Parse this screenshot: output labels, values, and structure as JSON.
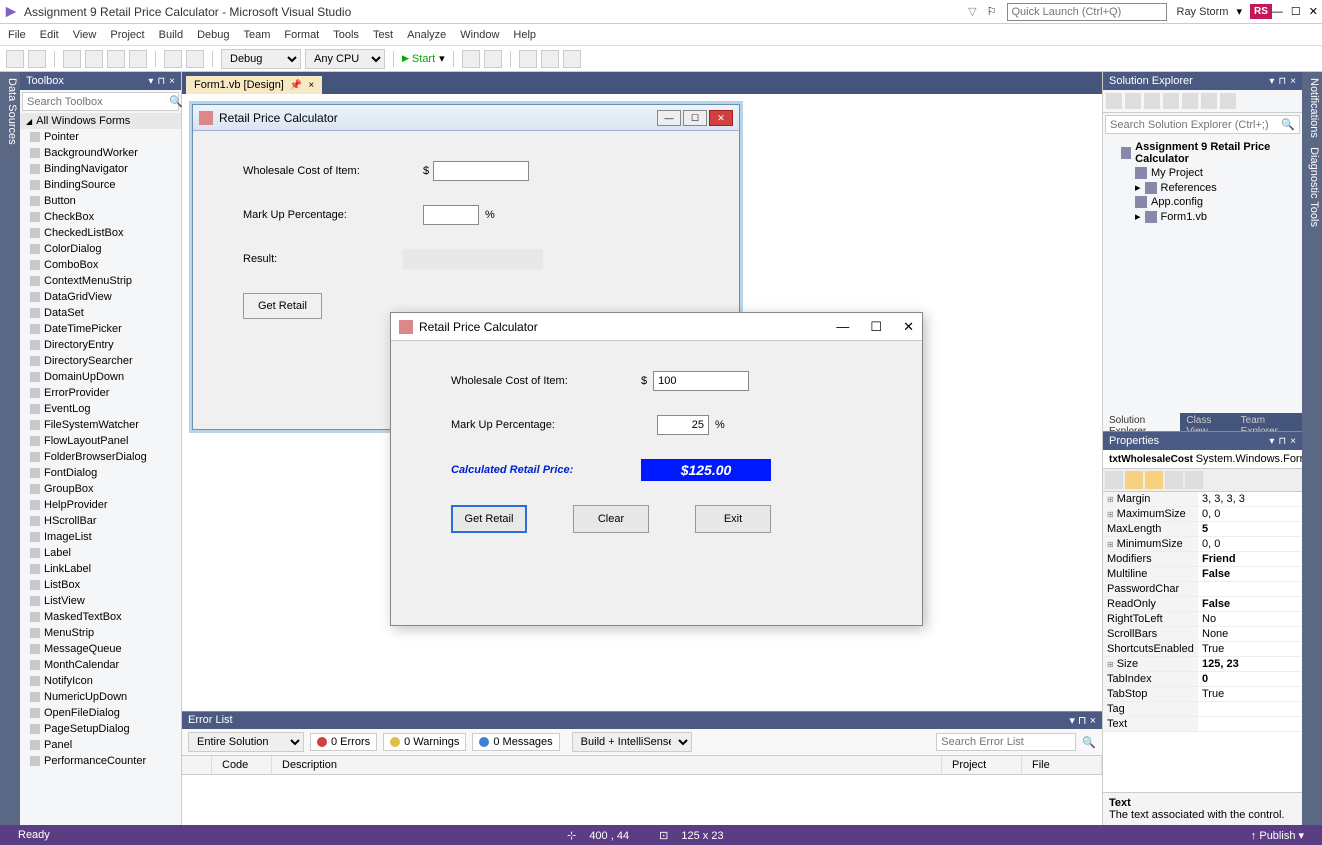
{
  "titlebar": {
    "app_title": "Assignment 9 Retail Price Calculator - Microsoft Visual Studio",
    "quicklaunch_placeholder": "Quick Launch (Ctrl+Q)",
    "user": "Ray Storm",
    "user_badge": "RS"
  },
  "menu": [
    "File",
    "Edit",
    "View",
    "Project",
    "Build",
    "Debug",
    "Team",
    "Format",
    "Tools",
    "Test",
    "Analyze",
    "Window",
    "Help"
  ],
  "toolbar": {
    "config": "Debug",
    "platform": "Any CPU",
    "start": "Start"
  },
  "left_strip": "Data Sources",
  "right_strip_top": "Notifications",
  "right_strip_bottom": "Diagnostic Tools",
  "toolbox": {
    "title": "Toolbox",
    "search_placeholder": "Search Toolbox",
    "category": "All Windows Forms",
    "items": [
      "Pointer",
      "BackgroundWorker",
      "BindingNavigator",
      "BindingSource",
      "Button",
      "CheckBox",
      "CheckedListBox",
      "ColorDialog",
      "ComboBox",
      "ContextMenuStrip",
      "DataGridView",
      "DataSet",
      "DateTimePicker",
      "DirectoryEntry",
      "DirectorySearcher",
      "DomainUpDown",
      "ErrorProvider",
      "EventLog",
      "FileSystemWatcher",
      "FlowLayoutPanel",
      "FolderBrowserDialog",
      "FontDialog",
      "GroupBox",
      "HelpProvider",
      "HScrollBar",
      "ImageList",
      "Label",
      "LinkLabel",
      "ListBox",
      "ListView",
      "MaskedTextBox",
      "MenuStrip",
      "MessageQueue",
      "MonthCalendar",
      "NotifyIcon",
      "NumericUpDown",
      "OpenFileDialog",
      "PageSetupDialog",
      "Panel",
      "PerformanceCounter"
    ]
  },
  "tab": {
    "name": "Form1.vb [Design]"
  },
  "design_form": {
    "title": "Retail Price Calculator",
    "wholesale_label": "Wholesale Cost of Item:",
    "dollar": "$",
    "markup_label": "Mark Up Percentage:",
    "percent": "%",
    "result_label": "Result:",
    "get_retail": "Get Retail"
  },
  "running_form": {
    "title": "Retail Price Calculator",
    "wholesale_label": "Wholesale Cost of Item:",
    "wholesale_value": "100",
    "dollar": "$",
    "markup_label": "Mark Up Percentage:",
    "markup_value": "25",
    "percent": "%",
    "calc_label": "Calculated Retail Price:",
    "calc_value": "$125.00",
    "btn_get": "Get Retail",
    "btn_clear": "Clear",
    "btn_exit": "Exit"
  },
  "errorlist": {
    "title": "Error List",
    "scope": "Entire Solution",
    "errors": "0 Errors",
    "warnings": "0 Warnings",
    "messages": "0 Messages",
    "build": "Build + IntelliSense",
    "search_placeholder": "Search Error List",
    "cols": [
      "",
      "Code",
      "Description",
      "Project",
      "File"
    ]
  },
  "solution": {
    "title": "Solution Explorer",
    "search_placeholder": "Search Solution Explorer (Ctrl+;)",
    "tabs": [
      "Solution Explorer",
      "Class View",
      "Team Explorer"
    ],
    "nodes": {
      "project": "Assignment 9 Retail Price Calculator",
      "myproject": "My Project",
      "refs": "References",
      "appconfig": "App.config",
      "form1": "Form1.vb"
    }
  },
  "properties": {
    "title": "Properties",
    "object": "txtWholesaleCost",
    "object_type": "System.Windows.Forms.",
    "rows": [
      {
        "name": "Margin",
        "value": "3, 3, 3, 3",
        "exp": true
      },
      {
        "name": "MaximumSize",
        "value": "0, 0",
        "exp": true
      },
      {
        "name": "MaxLength",
        "value": "5",
        "bold": true
      },
      {
        "name": "MinimumSize",
        "value": "0, 0",
        "exp": true
      },
      {
        "name": "Modifiers",
        "value": "Friend",
        "bold": true
      },
      {
        "name": "Multiline",
        "value": "False",
        "bold": true
      },
      {
        "name": "PasswordChar",
        "value": ""
      },
      {
        "name": "ReadOnly",
        "value": "False",
        "bold": true
      },
      {
        "name": "RightToLeft",
        "value": "No"
      },
      {
        "name": "ScrollBars",
        "value": "None"
      },
      {
        "name": "ShortcutsEnabled",
        "value": "True"
      },
      {
        "name": "Size",
        "value": "125, 23",
        "bold": true,
        "exp": true
      },
      {
        "name": "TabIndex",
        "value": "0",
        "bold": true
      },
      {
        "name": "TabStop",
        "value": "True"
      },
      {
        "name": "Tag",
        "value": ""
      },
      {
        "name": "Text",
        "value": ""
      }
    ],
    "desc_name": "Text",
    "desc_text": "The text associated with the control."
  },
  "statusbar": {
    "ready": "Ready",
    "pos": "400 , 44",
    "size": "125 x 23",
    "publish": "↑ Publish ▾"
  }
}
